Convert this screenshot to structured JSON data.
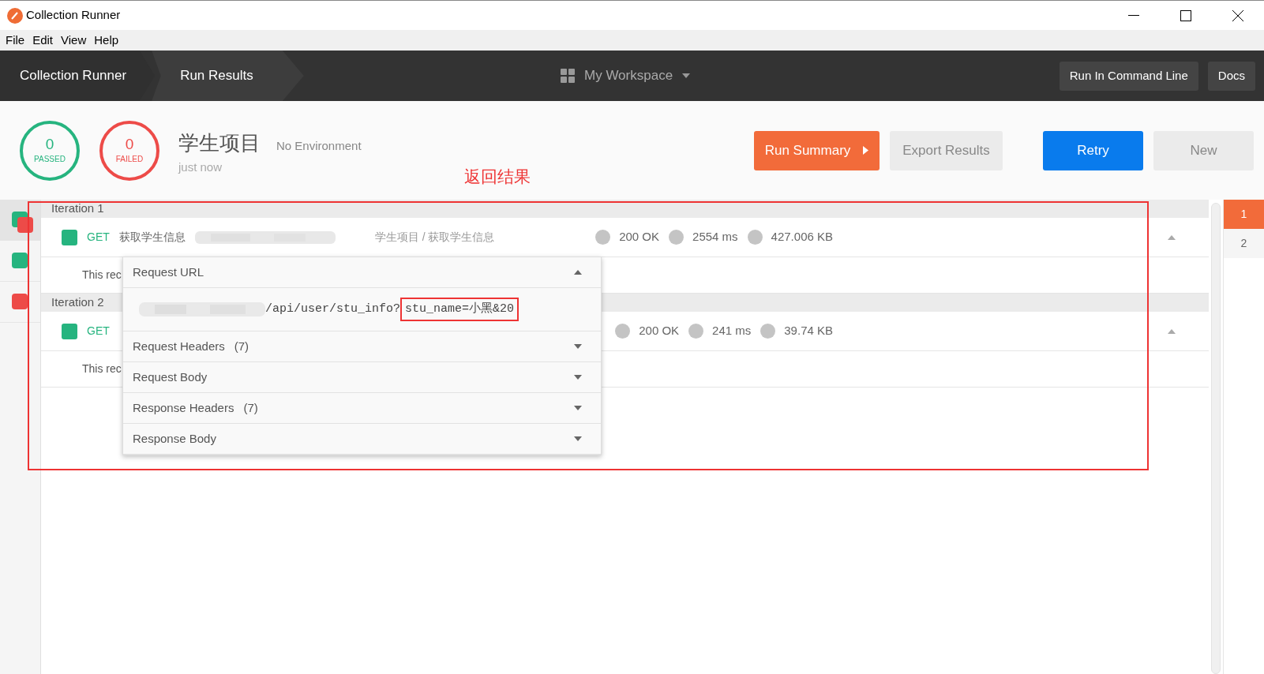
{
  "window": {
    "title": "Collection Runner"
  },
  "menu": [
    "File",
    "Edit",
    "View",
    "Help"
  ],
  "breadcrumbs": [
    {
      "label": "Collection Runner",
      "selected": false
    },
    {
      "label": "Run Results",
      "selected": true
    }
  ],
  "workspace": "My Workspace",
  "header_buttons": [
    "Run In Command Line",
    "Docs"
  ],
  "summary": {
    "passed": {
      "count": "0",
      "label": "PASSED"
    },
    "failed": {
      "count": "0",
      "label": "FAILED"
    },
    "collection": "学生项目",
    "environment": "No Environment",
    "time": "just now"
  },
  "actions": [
    {
      "label": "Run Summary",
      "kind": "orange"
    },
    {
      "label": "Export Results",
      "kind": "gray"
    },
    {
      "label": "Retry",
      "kind": "blue"
    },
    {
      "label": "New",
      "kind": "gray"
    }
  ],
  "annotation": {
    "text": "返回结果"
  },
  "sidebar": {
    "items": [
      {
        "selected": true,
        "markers": [
          {
            "color": "#26b47f"
          },
          {
            "color": "#ed4b48"
          }
        ]
      },
      {
        "selected": false,
        "markers": [
          {
            "color": "#26b47f"
          }
        ]
      },
      {
        "selected": false,
        "markers": [
          {
            "color": "#ed4b48"
          }
        ]
      }
    ]
  },
  "iterations": [
    {
      "title": "Iteration 1",
      "requests": [
        {
          "color": "#26b47f",
          "method": "GET",
          "name": "获取学生信息",
          "path": "学生项目 / 获取学生信息",
          "status": "200 OK",
          "time": "2554 ms",
          "size": "427.006 KB",
          "expanded": true,
          "note": "This rec"
        }
      ]
    },
    {
      "title": "Iteration 2",
      "requests": [
        {
          "color": "#26b47f",
          "method": "GET",
          "status": "200 OK",
          "time": "241 ms",
          "size": "39.74 KB",
          "expanded": true,
          "note": "This rec"
        }
      ]
    }
  ],
  "details": {
    "sections": [
      {
        "title": "Request URL",
        "expanded": true,
        "url": "/api/user/stu_info?",
        "highlight": "stu_name=小黑&20"
      },
      {
        "title": "Request Headers",
        "count": "(7)",
        "expanded": false
      },
      {
        "title": "Request Body",
        "expanded": false
      },
      {
        "title": "Response Headers",
        "count": "(7)",
        "expanded": false
      },
      {
        "title": "Response Body",
        "expanded": false
      }
    ]
  },
  "pages": [
    {
      "label": "1",
      "selected": true
    },
    {
      "label": "2",
      "selected": false
    }
  ]
}
